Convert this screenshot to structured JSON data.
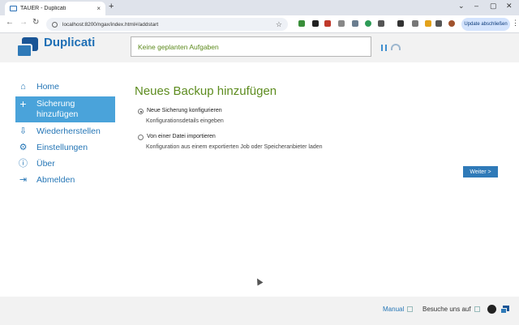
{
  "browser": {
    "tab_title": "TAUER - Duplicati",
    "tab_close": "×",
    "new_tab": "+",
    "window_controls": [
      "⌄",
      "–",
      "▢",
      "✕"
    ],
    "url": "localhost:8200/ngax/index.html#/addstart",
    "update_button": "Update abschließen",
    "back": "←",
    "forward": "→",
    "reload": "↻",
    "star": "☆",
    "menu": "⋮"
  },
  "header": {
    "logo_text": "Duplicati",
    "status_text": "Keine geplanten Aufgaben"
  },
  "sidebar": {
    "items": [
      {
        "label": "Home",
        "icon": "home-icon",
        "glyph": "⌂"
      },
      {
        "label": "Sicherung hinzufügen",
        "icon": "plus-icon",
        "glyph": "+",
        "active": true
      },
      {
        "label": "Wiederherstellen",
        "icon": "restore-icon",
        "glyph": "⇩"
      },
      {
        "label": "Einstellungen",
        "icon": "gear-icon",
        "glyph": "⚙"
      },
      {
        "label": "Über",
        "icon": "info-icon",
        "glyph": "ⓘ"
      },
      {
        "label": "Abmelden",
        "icon": "logout-icon",
        "glyph": "⇥"
      }
    ]
  },
  "main": {
    "title": "Neues Backup hinzufügen",
    "options": [
      {
        "label": "Neue Sicherung konfigurieren",
        "description": "Konfigurationsdetails eingeben",
        "selected": true
      },
      {
        "label": "Von einer Datei importieren",
        "description": "Konfiguration aus einem exportierten Job oder Speicheranbieter laden",
        "selected": false
      }
    ],
    "next_button": "Weiter >"
  },
  "footer": {
    "manual": "Manual",
    "visit": "Besuche uns auf"
  },
  "colors": {
    "accent": "#2f7ab8",
    "active_nav": "#4aa3da",
    "title_green": "#5d8c1f"
  }
}
